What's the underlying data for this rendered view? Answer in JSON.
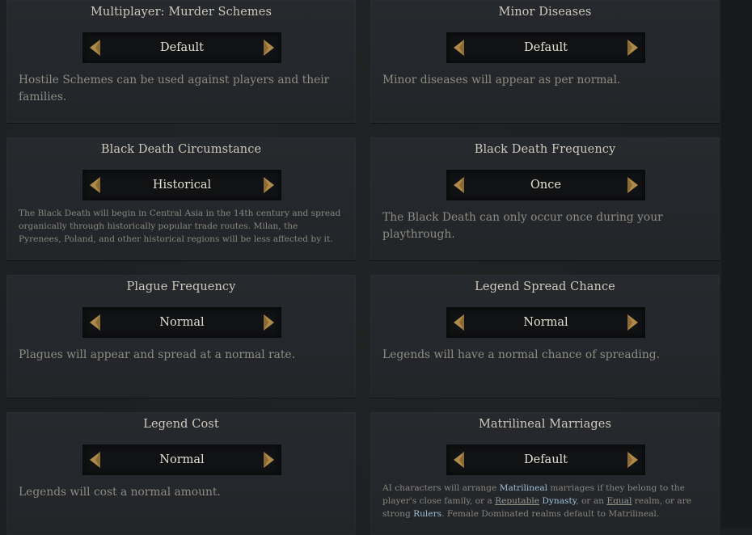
{
  "cards": [
    {
      "title": "Multiplayer: Murder Schemes",
      "value": "Default",
      "description": "Hostile Schemes can be used against players and their families."
    },
    {
      "title": "Minor Diseases",
      "value": "Default",
      "description": "Minor diseases will appear as per normal."
    },
    {
      "title": "Black Death Circumstance",
      "value": "Historical",
      "description": "The Black Death will begin in Central Asia in the 14th century and spread organically through historically popular trade routes. Milan, the Pyrenees, Poland, and other historical regions will be less affected by it."
    },
    {
      "title": "Black Death Frequency",
      "value": "Once",
      "description": "The Black Death can only occur once during your playthrough."
    },
    {
      "title": "Plague Frequency",
      "value": "Normal",
      "description": "Plagues will appear and spread at a normal rate."
    },
    {
      "title": "Legend Spread Chance",
      "value": "Normal",
      "description": "Legends will have a normal chance of spreading."
    },
    {
      "title": "Legend Cost",
      "value": "Normal",
      "description": "Legends will cost a normal amount."
    },
    {
      "title": "Matrilineal Marriages",
      "value": "Default",
      "description_parts": {
        "p1": "AI characters will arrange ",
        "k1": "Matrilineal",
        "p2": " marriages if they belong to the player's close family, or a ",
        "k2": "Reputable",
        "p3": " ",
        "k3": "Dynasty",
        "p4": ", or an ",
        "k4": "Equal",
        "p5": " realm, or are strong ",
        "k5": "Rulers",
        "p6": ". Female Dominated realms default to Matrilineal."
      }
    }
  ],
  "colors": {
    "background": "#1c1e21",
    "card": "#25282c",
    "title_text": "#cfc9bd",
    "value_text": "#e4dfd3",
    "description_text": "#8f8b83",
    "arrow": "#b08a4a",
    "keyword": "#9ec0d8"
  },
  "icons": {
    "left_arrow": "triangle-left-icon",
    "right_arrow": "triangle-right-icon"
  }
}
